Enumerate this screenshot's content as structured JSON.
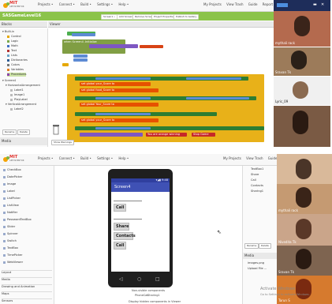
{
  "top": {
    "header": {
      "logo_text": "MIT",
      "logo_sub": "APP INVENTOR",
      "menus": [
        "Projects •",
        "Connect •",
        "Build •",
        "Settings •",
        "Help •"
      ],
      "right_links": [
        "My Projects",
        "View Trash",
        "Guide",
        "Report"
      ],
      "project_name": "SASGameLevel16",
      "toolbar_buttons": [
        "Screen1 •",
        "Add Screen",
        "Remove Screen",
        "Project Properties",
        "Publish to Gallery"
      ]
    },
    "blocks_panel": {
      "title": "Blocks",
      "items": [
        "Built-in",
        "Control",
        "Logic",
        "Math",
        "Text",
        "Lists",
        "Dictionaries",
        "Colors",
        "Variables",
        "Procedures",
        "Screen4",
        "HorizontalArrangement",
        "Label1",
        "Image1",
        "PlayLabel",
        "VerticalArrangement",
        "Label2"
      ],
      "rename_button": "Rename",
      "delete_button": "Delete"
    },
    "viewer": {
      "title": "Viewer",
      "warnings_button": "Show Warnings",
      "block_texts": [
        "set Image1 . Picture to",
        "when Screen4 .Initialize",
        "random integer from 1 to 6",
        "set global your_Score to",
        "set global food_Score to",
        "set global Your_Score to",
        "set global your_Score to",
        "You are orange winning",
        "Stop Game"
      ]
    },
    "participants": [
      {
        "name": "",
        "color": "#b46a4e"
      },
      {
        "name": "Sravan Tk",
        "color": "#9c7b5a"
      },
      {
        "name": "Lyric_09",
        "color": "#f0f0f0"
      },
      {
        "name": "",
        "color": "#7a5a44"
      }
    ],
    "participant_top_name": "mythali rack"
  },
  "bottom": {
    "header": {
      "logo_text": "MIT",
      "logo_sub": "APP INVENTOR",
      "menus": [
        "Projects •",
        "Connect •",
        "Build •",
        "Settings •",
        "Help •"
      ],
      "right_links": [
        "My Projects",
        "View Trash",
        "Guide"
      ]
    },
    "palette": {
      "items": [
        "CheckBox",
        "DatePicker",
        "Image",
        "Label",
        "ListPicker",
        "ListView",
        "Notifier",
        "PasswordTextBox",
        "Slider",
        "Spinner",
        "Switch",
        "TextBox",
        "TimePicker",
        "WebViewer"
      ],
      "sections": [
        "Layout",
        "Media",
        "Drawing and Animation",
        "Maps",
        "Sensors"
      ]
    },
    "phone": {
      "time": "9:48",
      "screen_title": "Screen4",
      "buttons": [
        "Call",
        "Share",
        "Contacts",
        "Call"
      ],
      "nonvisible_label": "Non-visible components",
      "nonvisible_items": [
        "PhoneCall",
        "Sharing1"
      ],
      "display_hidden": "Display hidden components in Viewer"
    },
    "components": {
      "items": [
        "TextBox1",
        "Share",
        "Call",
        "Contacts",
        "Sharing1"
      ],
      "rename_button": "Rename",
      "delete_button": "Delete",
      "media_title": "Media",
      "media_items": [
        "images.png",
        "Upload File ..."
      ]
    },
    "participants": [
      {
        "name": "",
        "color": "#d9b99a"
      },
      {
        "name": "mythali rack",
        "color": "#c59a72"
      },
      {
        "name": "Nivedita Tk",
        "color": "#caa58a"
      },
      {
        "name": "Sravan Tk",
        "color": "#7e6450"
      },
      {
        "name": "Tarun S",
        "color": "#d67a2e"
      }
    ],
    "activate_windows": [
      "Activate Windows",
      "Go to Settings to activate Windows."
    ]
  }
}
